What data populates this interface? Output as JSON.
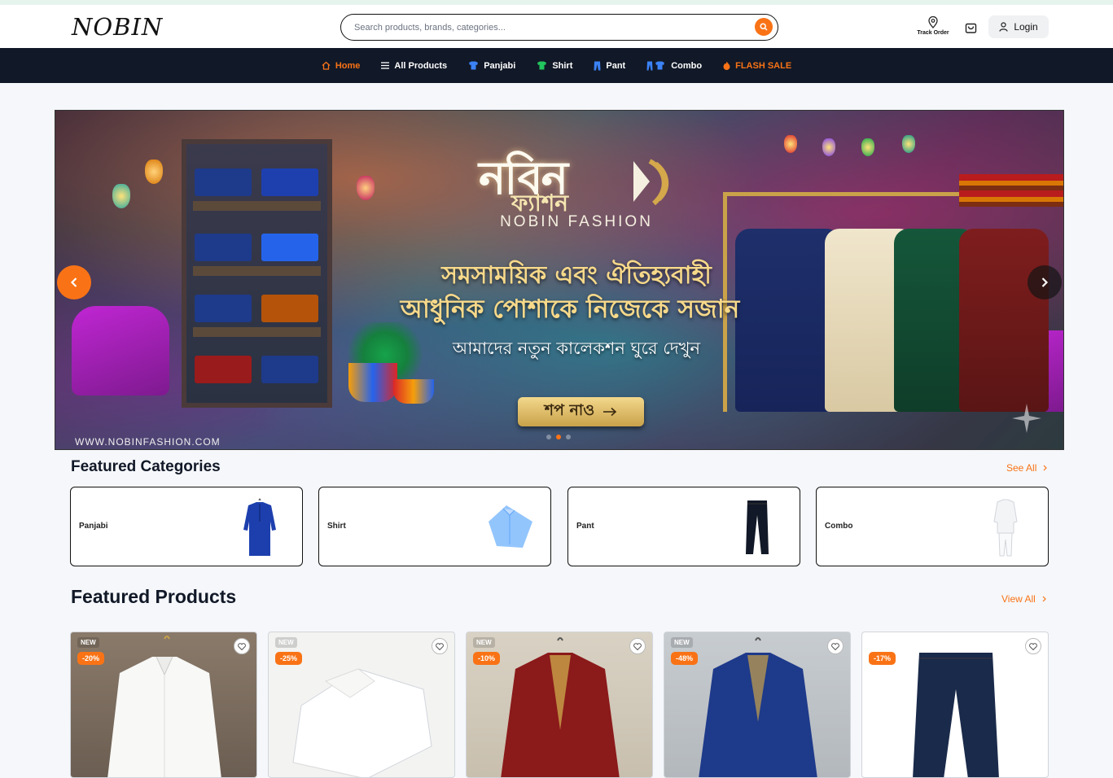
{
  "header": {
    "logo": "NOBIN",
    "search_placeholder": "Search products, brands, categories...",
    "track_order": "Track Order",
    "login": "Login"
  },
  "nav": {
    "items": [
      {
        "label": "Home",
        "icon": "home-icon"
      },
      {
        "label": "All Products",
        "icon": "menu-icon"
      },
      {
        "label": "Panjabi",
        "icon": "panjabi-icon"
      },
      {
        "label": "Shirt",
        "icon": "shirt-icon"
      },
      {
        "label": "Pant",
        "icon": "pant-icon"
      },
      {
        "label": "Combo",
        "icon": "combo-icon"
      },
      {
        "label": "FLASH SALE",
        "icon": "fire-icon"
      }
    ]
  },
  "banner": {
    "brand_bn": "নবিন",
    "brand_bn_sub": "ফ্যাশন",
    "brand_en": "NOBIN FASHION",
    "tagline_1": "সমসাময়িক এবং ঐতিহ্যবাহী",
    "tagline_2": "আধুনিক পোশাকে নিজেকে সজান",
    "tagline_3": "আমাদের নতুন কালেকশন ঘুরে দেখুন",
    "cta": "শপ নাও",
    "watermark": "WWW.NOBINFASHION.COM",
    "slide_index": 2,
    "slide_count": 3
  },
  "featured_categories": {
    "title": "Featured Categories",
    "see_all": "See All",
    "items": [
      {
        "label": "Panjabi"
      },
      {
        "label": "Shirt"
      },
      {
        "label": "Pant"
      },
      {
        "label": "Combo"
      }
    ]
  },
  "featured_products": {
    "title": "Featured Products",
    "view_all": "View All",
    "items": [
      {
        "badge": "NEW",
        "discount": "-20%"
      },
      {
        "badge": "NEW",
        "discount": "-25%"
      },
      {
        "badge": "NEW",
        "discount": "-10%"
      },
      {
        "badge": "NEW",
        "discount": "-48%"
      },
      {
        "badge": "",
        "discount": "-17%"
      }
    ]
  },
  "colors": {
    "accent": "#f97316",
    "nav_bg": "#111827",
    "page_bg": "#f5f7fa"
  }
}
